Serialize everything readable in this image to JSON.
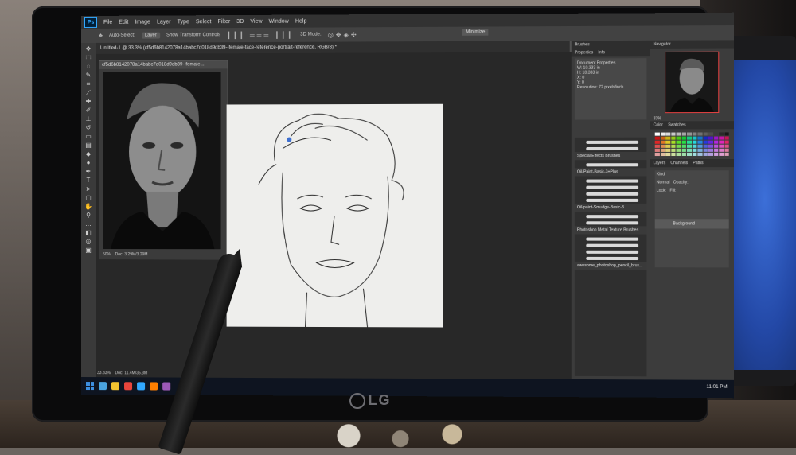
{
  "menu": [
    "File",
    "Edit",
    "Image",
    "Layer",
    "Type",
    "Select",
    "Filter",
    "3D",
    "View",
    "Window",
    "Help"
  ],
  "options": {
    "auto_select": "Auto-Select:",
    "layer": "Layer",
    "show_transform": "Show Transform Controls",
    "mode_3d": "3D Mode:",
    "minimize": "Minimize"
  },
  "tabs": {
    "untitled": "Untitled-1 @ 33.3% (cf5d6b8142078a14babc7d018d9db39--female-face-reference-portrait-reference, RGB/8) *"
  },
  "doc_window": {
    "title": "cf5d6b8142078a14babc7d018d9db39--female...",
    "zoom": "50%",
    "doc_size": "Doc: 3.29M/3.29M"
  },
  "workspace": {
    "zoom": "33.33%",
    "doc_size": "Doc: 11.4M/35.3M"
  },
  "mid_panel": {
    "tab_brushes": "Brushes",
    "tab_properties": "Properties",
    "tab_info": "Info",
    "doc_props": "Document Properties",
    "w_value": "W: 10.333 in",
    "h_value": "H: 10.333 in",
    "x_value": "X: 0",
    "y_value": "Y: 0",
    "resolution": "Resolution: 72 pixels/inch",
    "brush_groups": [
      "Special Effects Brushes",
      "Oil-Paint-Basic-3+Plus",
      "Oil-paint-Smudge-Basic-3",
      "Photoshop Metal Texture Brushes",
      "awesome_photoshop_pencil_brus..."
    ]
  },
  "right_panel": {
    "navigator": "Navigator",
    "nav_zoom": "33%",
    "color": "Color",
    "swatches": "Swatches",
    "layers": "Layers",
    "channels": "Channels",
    "paths": "Paths",
    "kind": "Kind",
    "normal": "Normal",
    "opacity": "Opacity:",
    "lock": "Lock:",
    "fill": "Fill:",
    "background_layer": "Background"
  },
  "taskbar": {
    "clock": "11:01 PM"
  },
  "brand": "LG",
  "colors": {
    "ps_blue": "#31a8ff",
    "screen_bg": "#535353",
    "canvas": "#eeeeec",
    "nav_frame": "#e04040"
  }
}
